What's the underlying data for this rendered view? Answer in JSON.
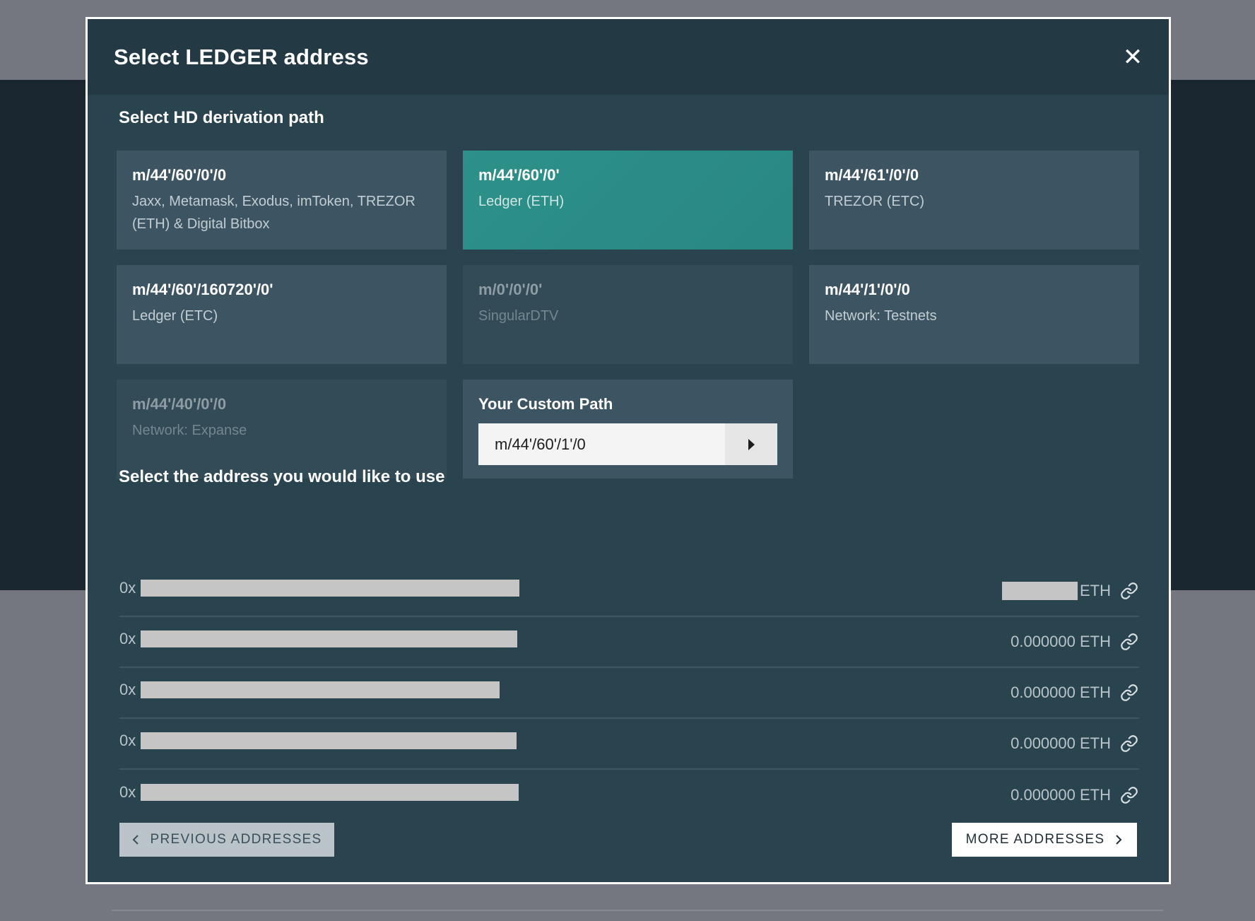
{
  "modal": {
    "title": "Select LEDGER address",
    "close_icon": "close-icon"
  },
  "derivation": {
    "section_title": "Select HD derivation path",
    "paths": [
      {
        "code": "m/44'/60'/0'/0",
        "desc": "Jaxx, Metamask, Exodus, imToken, TREZOR (ETH) & Digital Bitbox",
        "state": "normal"
      },
      {
        "code": "m/44'/60'/0'",
        "desc": "Ledger (ETH)",
        "state": "selected"
      },
      {
        "code": "m/44'/61'/0'/0",
        "desc": "TREZOR (ETC)",
        "state": "normal"
      },
      {
        "code": "m/44'/60'/160720'/0'",
        "desc": "Ledger (ETC)",
        "state": "normal"
      },
      {
        "code": "m/0'/0'/0'",
        "desc": "SingularDTV",
        "state": "dimmed"
      },
      {
        "code": "m/44'/1'/0'/0",
        "desc": "Network: Testnets",
        "state": "normal"
      },
      {
        "code": "m/44'/40'/0'/0",
        "desc": "Network: Expanse",
        "state": "dimmed"
      }
    ],
    "custom": {
      "label": "Your Custom Path",
      "value": "m/44'/60'/1'/0",
      "go_icon": "play-triangle-icon"
    }
  },
  "addresses": {
    "section_title": "Select the address you would like to use",
    "rows": [
      {
        "prefix": "0x",
        "balance": "",
        "unit": "ETH",
        "balance_hidden": true
      },
      {
        "prefix": "0x",
        "balance": "0.000000",
        "unit": "ETH",
        "balance_hidden": false
      },
      {
        "prefix": "0x",
        "balance": "0.000000",
        "unit": "ETH",
        "balance_hidden": false
      },
      {
        "prefix": "0x",
        "balance": "0.000000",
        "unit": "ETH",
        "balance_hidden": false
      },
      {
        "prefix": "0x",
        "balance": "0.000000",
        "unit": "ETH",
        "balance_hidden": false
      }
    ],
    "link_icon": "external-link-icon"
  },
  "pagination": {
    "prev_label": "PREVIOUS ADDRESSES",
    "more_label": "MORE ADDRESSES"
  },
  "colors": {
    "modal_bg": "#29434f",
    "header_bg": "#233944",
    "card_bg": "#3d5562",
    "selected_card": "#2c918a"
  }
}
